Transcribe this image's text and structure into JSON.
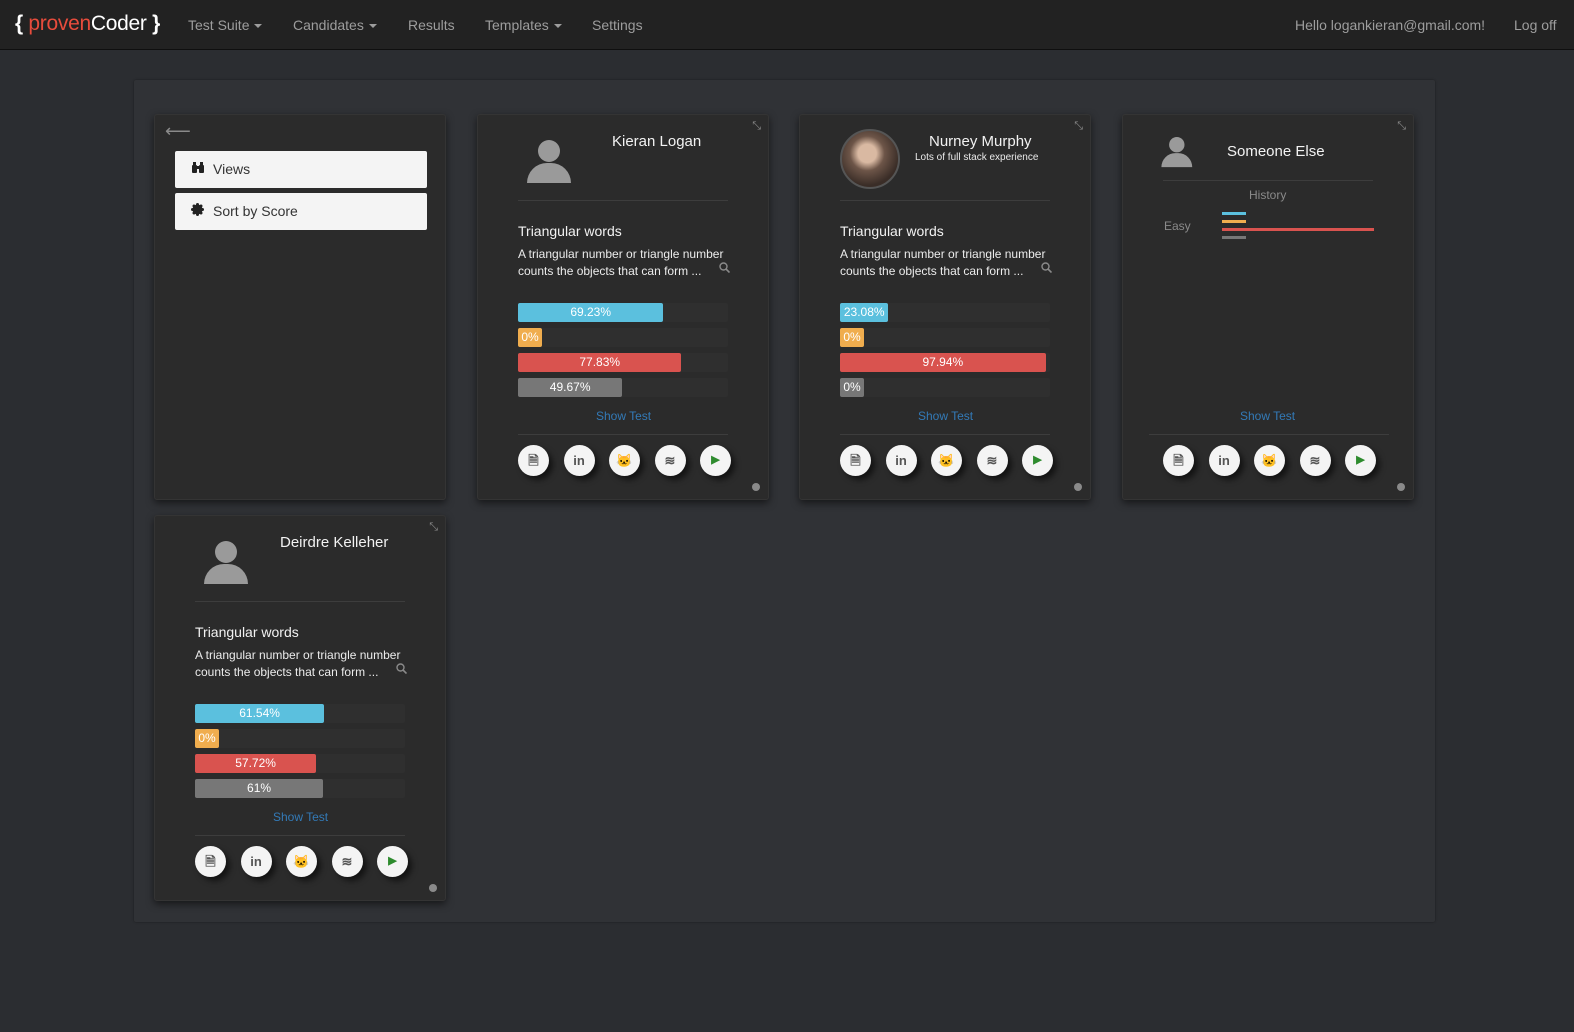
{
  "brand": {
    "open": "{",
    "proven": "proven",
    "coder": "Coder",
    "close": "}"
  },
  "nav": {
    "test_suite": "Test Suite",
    "candidates": "Candidates",
    "results": "Results",
    "templates": "Templates",
    "settings": "Settings",
    "greeting": "Hello logankieran@gmail.com!",
    "logoff": "Log off"
  },
  "sidebar": {
    "back": "⟵",
    "views": "Views",
    "sort_by_score": "Sort by Score"
  },
  "colors": {
    "blue": "#5bc0de",
    "orange": "#f0ad4e",
    "red": "#d9534f",
    "gray": "#777777"
  },
  "cards": [
    {
      "name": "Kieran Logan",
      "subtitle": "",
      "test_title": "Triangular words",
      "test_desc": "A triangular number or triangle number counts the objects that can form ...",
      "bars": [
        {
          "label": "69.23%",
          "value": 69.23
        },
        {
          "label": "0%",
          "value": 0
        },
        {
          "label": "77.83%",
          "value": 77.83
        },
        {
          "label": "49.67%",
          "value": 49.67
        }
      ],
      "show_test": "Show Test"
    },
    {
      "name": "Nurney Murphy",
      "subtitle": "Lots of full stack experience",
      "test_title": "Triangular words",
      "test_desc": "A triangular number or triangle number counts the objects that can form ...",
      "bars": [
        {
          "label": "23.08%",
          "value": 23.08
        },
        {
          "label": "0%",
          "value": 0
        },
        {
          "label": "97.94%",
          "value": 97.94
        },
        {
          "label": "0%",
          "value": 0
        }
      ],
      "show_test": "Show Test"
    },
    {
      "name": "Someone Else",
      "history_title": "History",
      "history_label": "Easy",
      "show_test": "Show Test"
    },
    {
      "name": "Deirdre Kelleher",
      "subtitle": "",
      "test_title": "Triangular words",
      "test_desc": "A triangular number or triangle number counts the objects that can form ...",
      "bars": [
        {
          "label": "61.54%",
          "value": 61.54
        },
        {
          "label": "0%",
          "value": 0
        },
        {
          "label": "57.72%",
          "value": 57.72
        },
        {
          "label": "61%",
          "value": 61
        }
      ],
      "show_test": "Show Test"
    }
  ],
  "icons": [
    "document-icon",
    "linkedin-icon",
    "github-icon",
    "stackoverflow-icon",
    "play-icon"
  ],
  "icon_glyphs": {
    "document": "🗎",
    "linkedin": "in",
    "github": "🐱",
    "stackoverflow": "≋",
    "play": "▶"
  }
}
